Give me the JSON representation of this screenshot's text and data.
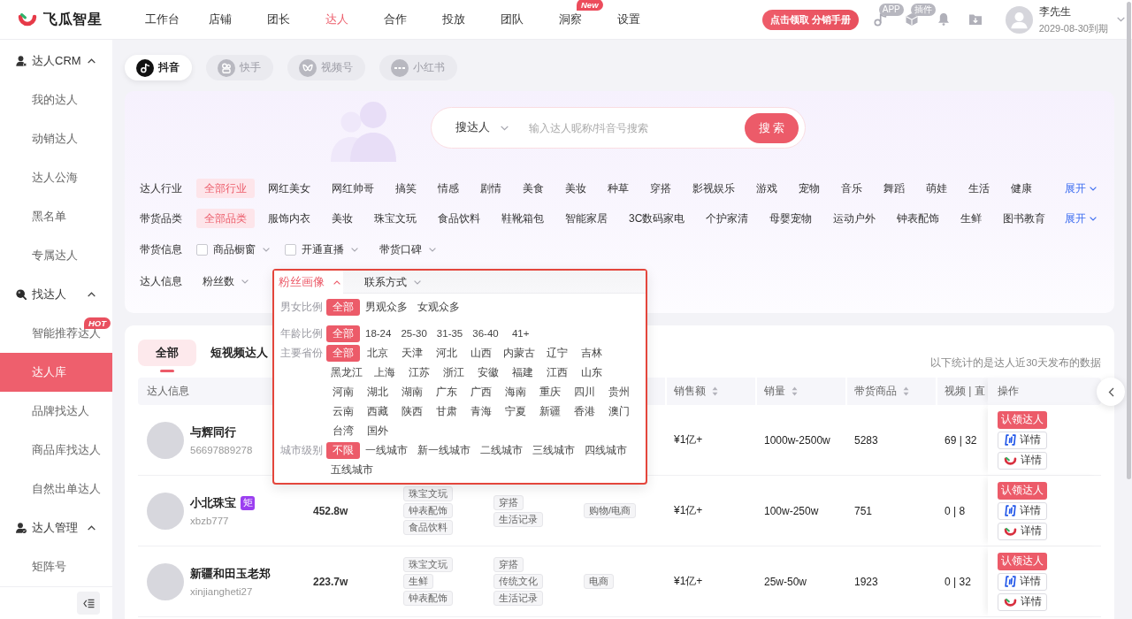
{
  "header": {
    "logo_text": "飞瓜智星",
    "nav": [
      {
        "label": "工作台",
        "selected": false
      },
      {
        "label": "店铺",
        "selected": false
      },
      {
        "label": "团长",
        "selected": false
      },
      {
        "label": "达人",
        "selected": true
      },
      {
        "label": "合作",
        "selected": false
      },
      {
        "label": "投放",
        "selected": false
      },
      {
        "label": "团队",
        "selected": false
      },
      {
        "label": "洞察",
        "selected": false,
        "badge": "New"
      },
      {
        "label": "设置",
        "selected": false
      }
    ],
    "promo_button": "点击领取 分销手册",
    "tools": [
      {
        "kind": "app",
        "badge": "APP"
      },
      {
        "kind": "plugin",
        "badge": "插件"
      },
      {
        "kind": "notifications"
      },
      {
        "kind": "downloads"
      }
    ],
    "user": {
      "name": "李先生",
      "expiry": "2029-08-30到期"
    }
  },
  "sidebar": {
    "groups": [
      {
        "label": "达人CRM",
        "kind": "crm",
        "expanded": true,
        "items": [
          {
            "label": "我的达人",
            "selected": false
          },
          {
            "label": "动销达人",
            "selected": false
          },
          {
            "label": "达人公海",
            "selected": false
          },
          {
            "label": "黑名单",
            "selected": false
          },
          {
            "label": "专属达人",
            "selected": false
          }
        ]
      },
      {
        "label": "找达人",
        "kind": "find",
        "expanded": true,
        "items": [
          {
            "label": "智能推荐达人",
            "selected": false,
            "badge": "HOT"
          },
          {
            "label": "达人库",
            "selected": true
          },
          {
            "label": "品牌找达人",
            "selected": false
          },
          {
            "label": "商品库找达人",
            "selected": false
          },
          {
            "label": "自然出单达人",
            "selected": false
          }
        ]
      },
      {
        "label": "达人管理",
        "kind": "manage",
        "expanded": true,
        "items": [
          {
            "label": "矩阵号",
            "selected": false
          }
        ]
      }
    ]
  },
  "platform_tabs": [
    {
      "label": "抖音",
      "kind": "douyin",
      "selected": true
    },
    {
      "label": "快手",
      "kind": "kuaishou",
      "selected": false
    },
    {
      "label": "视频号",
      "kind": "channels",
      "selected": false
    },
    {
      "label": "小红书",
      "kind": "xiaohongshu",
      "selected": false
    }
  ],
  "filters": {
    "search": {
      "scope": "搜达人",
      "placeholder": "输入达人昵称/抖音号搜索",
      "button": "搜 索"
    },
    "rows": [
      {
        "label": "达人行业",
        "kind": "chips",
        "more": "展开",
        "options": [
          {
            "label": "全部行业",
            "selected": true
          },
          {
            "label": "网红美女",
            "selected": false
          },
          {
            "label": "网红帅哥",
            "selected": false
          },
          {
            "label": "搞笑",
            "selected": false
          },
          {
            "label": "情感",
            "selected": false
          },
          {
            "label": "剧情",
            "selected": false
          },
          {
            "label": "美食",
            "selected": false
          },
          {
            "label": "美妆",
            "selected": false
          },
          {
            "label": "种草",
            "selected": false
          },
          {
            "label": "穿搭",
            "selected": false
          },
          {
            "label": "影视娱乐",
            "selected": false
          },
          {
            "label": "游戏",
            "selected": false
          },
          {
            "label": "宠物",
            "selected": false
          },
          {
            "label": "音乐",
            "selected": false
          },
          {
            "label": "舞蹈",
            "selected": false
          },
          {
            "label": "萌娃",
            "selected": false
          },
          {
            "label": "生活",
            "selected": false
          },
          {
            "label": "健康",
            "selected": false
          }
        ]
      },
      {
        "label": "带货品类",
        "kind": "chips",
        "more": "展开",
        "options": [
          {
            "label": "全部品类",
            "selected": true
          },
          {
            "label": "服饰内衣",
            "selected": false
          },
          {
            "label": "美妆",
            "selected": false
          },
          {
            "label": "珠宝文玩",
            "selected": false
          },
          {
            "label": "食品饮料",
            "selected": false
          },
          {
            "label": "鞋靴箱包",
            "selected": false
          },
          {
            "label": "智能家居",
            "selected": false
          },
          {
            "label": "3C数码家电",
            "selected": false
          },
          {
            "label": "个护家清",
            "selected": false
          },
          {
            "label": "母婴宠物",
            "selected": false
          },
          {
            "label": "运动户外",
            "selected": false
          },
          {
            "label": "钟表配饰",
            "selected": false
          },
          {
            "label": "生鲜",
            "selected": false
          },
          {
            "label": "图书教育",
            "selected": false
          }
        ]
      },
      {
        "label": "带货信息",
        "kind": "dropdowns",
        "options": [
          {
            "kind": "checkbox",
            "label": "商品橱窗",
            "checked": false,
            "open": false
          },
          {
            "kind": "checkbox",
            "label": "开通直播",
            "checked": false,
            "open": false
          },
          {
            "kind": "select",
            "label": "带货口碑",
            "open": false
          }
        ]
      },
      {
        "label": "达人信息",
        "kind": "dropdowns",
        "options": [
          {
            "kind": "select",
            "label": "粉丝数",
            "open": false
          },
          {
            "kind": "select",
            "label": "粉丝画像",
            "open": true,
            "panel": {
              "groups": [
                {
                  "label": "男女比例",
                  "options": [
                    {
                      "label": "全部",
                      "selected": true
                    },
                    {
                      "label": "男观众多",
                      "selected": false
                    },
                    {
                      "label": "女观众多",
                      "selected": false
                    }
                  ]
                },
                {
                  "label": "年龄比例",
                  "options": [
                    {
                      "label": "全部",
                      "selected": true
                    },
                    {
                      "label": "18-24",
                      "selected": false
                    },
                    {
                      "label": "25-30",
                      "selected": false
                    },
                    {
                      "label": "31-35",
                      "selected": false
                    },
                    {
                      "label": "36-40",
                      "selected": false
                    },
                    {
                      "label": "41+",
                      "selected": false
                    }
                  ]
                },
                {
                  "label": "主要省份",
                  "options": [
                    {
                      "label": "全部",
                      "selected": true
                    },
                    {
                      "label": "北京",
                      "selected": false
                    },
                    {
                      "label": "天津",
                      "selected": false
                    },
                    {
                      "label": "河北",
                      "selected": false
                    },
                    {
                      "label": "山西",
                      "selected": false
                    },
                    {
                      "label": "内蒙古",
                      "selected": false
                    },
                    {
                      "label": "辽宁",
                      "selected": false
                    },
                    {
                      "label": "吉林",
                      "selected": false
                    },
                    {
                      "label": "黑龙江",
                      "selected": false
                    },
                    {
                      "label": "上海",
                      "selected": false
                    },
                    {
                      "label": "江苏",
                      "selected": false
                    },
                    {
                      "label": "浙江",
                      "selected": false
                    },
                    {
                      "label": "安徽",
                      "selected": false
                    },
                    {
                      "label": "福建",
                      "selected": false
                    },
                    {
                      "label": "江西",
                      "selected": false
                    },
                    {
                      "label": "山东",
                      "selected": false
                    },
                    {
                      "label": "河南",
                      "selected": false
                    },
                    {
                      "label": "湖北",
                      "selected": false
                    },
                    {
                      "label": "湖南",
                      "selected": false
                    },
                    {
                      "label": "广东",
                      "selected": false
                    },
                    {
                      "label": "广西",
                      "selected": false
                    },
                    {
                      "label": "海南",
                      "selected": false
                    },
                    {
                      "label": "重庆",
                      "selected": false
                    },
                    {
                      "label": "四川",
                      "selected": false
                    },
                    {
                      "label": "贵州",
                      "selected": false
                    },
                    {
                      "label": "云南",
                      "selected": false
                    },
                    {
                      "label": "西藏",
                      "selected": false
                    },
                    {
                      "label": "陕西",
                      "selected": false
                    },
                    {
                      "label": "甘肃",
                      "selected": false
                    },
                    {
                      "label": "青海",
                      "selected": false
                    },
                    {
                      "label": "宁夏",
                      "selected": false
                    },
                    {
                      "label": "新疆",
                      "selected": false
                    },
                    {
                      "label": "香港",
                      "selected": false
                    },
                    {
                      "label": "澳门",
                      "selected": false
                    },
                    {
                      "label": "台湾",
                      "selected": false
                    },
                    {
                      "label": "国外",
                      "selected": false
                    }
                  ]
                },
                {
                  "label": "城市级别",
                  "options": [
                    {
                      "label": "不限",
                      "selected": true
                    },
                    {
                      "label": "一线城市",
                      "selected": false
                    },
                    {
                      "label": "新一线城市",
                      "selected": false
                    },
                    {
                      "label": "二线城市",
                      "selected": false
                    },
                    {
                      "label": "三线城市",
                      "selected": false
                    },
                    {
                      "label": "四线城市",
                      "selected": false
                    },
                    {
                      "label": "五线城市",
                      "selected": false
                    }
                  ]
                }
              ]
            }
          },
          {
            "kind": "select",
            "label": "联系方式",
            "open": false
          }
        ]
      }
    ]
  },
  "table": {
    "tabs": [
      {
        "label": "全部",
        "selected": true
      },
      {
        "label": "短视频达人",
        "selected": false
      }
    ],
    "note": "以下统计的是达人近30天发布的数据",
    "columns": [
      {
        "label": "达人信息",
        "sortable": false
      },
      {
        "label": "销售额",
        "sortable": true
      },
      {
        "label": "销量",
        "sortable": true
      },
      {
        "label": "带货商品",
        "sortable": true
      },
      {
        "label": "视频 | 直",
        "sortable": false
      },
      {
        "label": "操作",
        "sortable": false
      }
    ],
    "rows": [
      {
        "name": "与辉同行",
        "handle": "56697889278",
        "sales": "¥1亿+",
        "volume": "1000w-2500w",
        "goods": "5283",
        "video_live": "69 | 32",
        "actions": [
          {
            "kind": "claim",
            "label": "认领达人"
          },
          {
            "kind": "detail",
            "label": "详情"
          },
          {
            "kind": "detail",
            "label": "详情"
          }
        ]
      },
      {
        "name": "小北珠宝",
        "badge": "矩",
        "handle": "xbzb777",
        "fans": "452.8w",
        "product_tags": [
          "珠宝文玩",
          "钟表配饰",
          "食品饮料"
        ],
        "content_tags": [
          "穿搭",
          "生活记录"
        ],
        "industry_tags": [
          "购物/电商"
        ],
        "sales": "¥1亿+",
        "volume": "100w-250w",
        "goods": "751",
        "video_live": "0 | 8",
        "actions": [
          {
            "kind": "claim",
            "label": "认领达人"
          },
          {
            "kind": "detail",
            "label": "详情"
          },
          {
            "kind": "detail",
            "label": "详情"
          }
        ]
      },
      {
        "name": "新疆和田玉老郑",
        "handle": "xinjiangheti27",
        "fans": "223.7w",
        "product_tags": [
          "珠宝文玩",
          "生鲜",
          "钟表配饰"
        ],
        "content_tags": [
          "穿搭",
          "传统文化",
          "生活记录"
        ],
        "industry_tags": [
          "电商"
        ],
        "sales": "¥1亿+",
        "volume": "25w-50w",
        "goods": "1923",
        "video_live": "0 | 32",
        "actions": [
          {
            "kind": "claim",
            "label": "认领达人"
          },
          {
            "kind": "detail",
            "label": "详情"
          },
          {
            "kind": "detail",
            "label": "详情"
          }
        ]
      }
    ]
  }
}
